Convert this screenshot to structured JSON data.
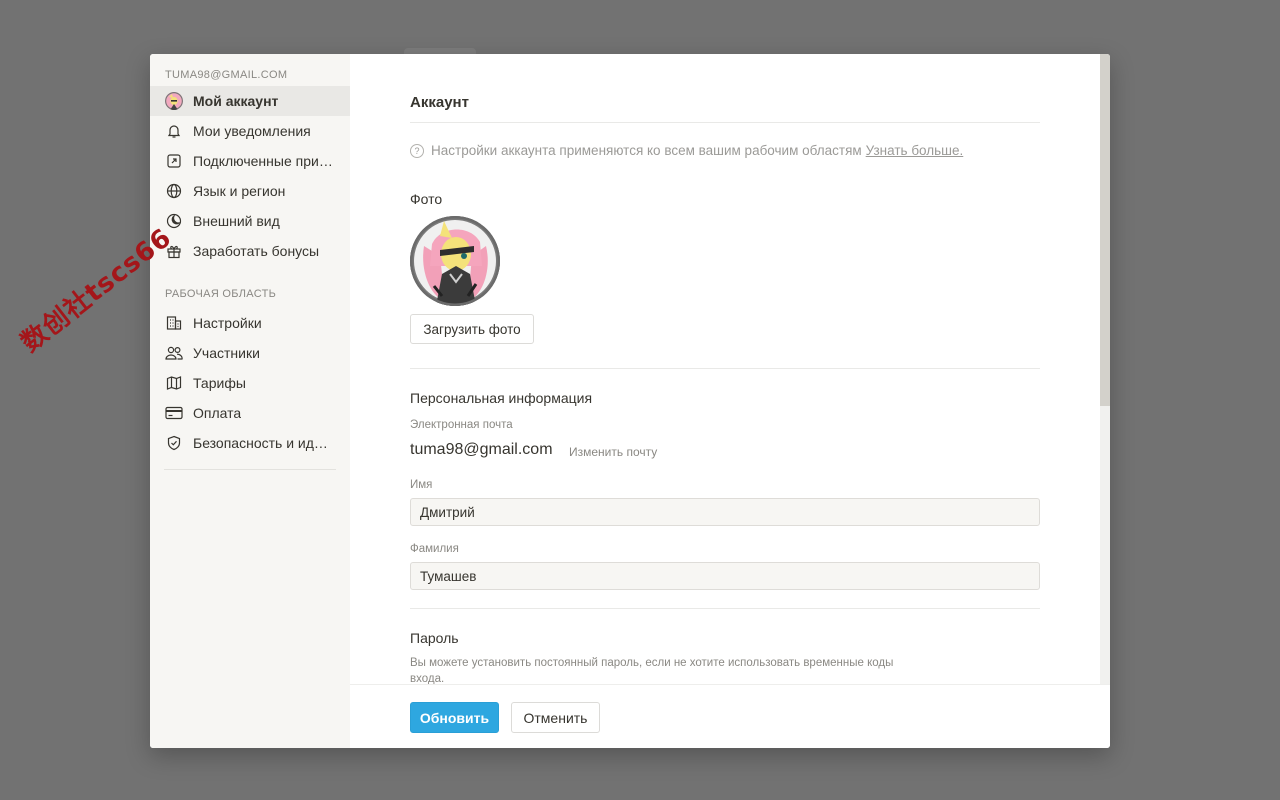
{
  "watermark": "数创社tscs66",
  "sidebar": {
    "account_email": "TUMA98@GMAIL.COM",
    "personal_items": [
      {
        "label": "Мой аккаунт",
        "icon": "user-avatar",
        "active": true
      },
      {
        "label": "Мои уведомления",
        "icon": "bell-icon"
      },
      {
        "label": "Подключенные приложения",
        "icon": "arrow-up-right-icon"
      },
      {
        "label": "Язык и регион",
        "icon": "globe-icon"
      },
      {
        "label": "Внешний вид",
        "icon": "moon-icon"
      },
      {
        "label": "Заработать бонусы",
        "icon": "gift-icon"
      }
    ],
    "workspace_header": "РАБОЧАЯ ОБЛАСТЬ",
    "workspace_items": [
      {
        "label": "Настройки",
        "icon": "building-icon"
      },
      {
        "label": "Участники",
        "icon": "people-icon"
      },
      {
        "label": "Тарифы",
        "icon": "map-icon"
      },
      {
        "label": "Оплата",
        "icon": "credit-card-icon"
      },
      {
        "label": "Безопасность и идентичность",
        "icon": "shield-check-icon"
      }
    ]
  },
  "main": {
    "title": "Аккаунт",
    "note_text": "Настройки аккаунта применяются ко всем вашим рабочим областям",
    "note_link": "Узнать больше.",
    "photo_label": "Фото",
    "upload_button": "Загрузить фото",
    "personal_info_header": "Персональная информация",
    "email_label": "Электронная почта",
    "email_value": "tuma98@gmail.com",
    "change_email": "Изменить почту",
    "first_name_label": "Имя",
    "first_name_value": "Дмитрий",
    "last_name_label": "Фамилия",
    "last_name_value": "Тумашев",
    "password_header": "Пароль",
    "password_desc": "Вы можете установить постоянный пароль, если не хотите использовать временные коды входа."
  },
  "footer": {
    "update_button": "Обновить",
    "cancel_button": "Отменить"
  },
  "colors": {
    "backdrop": "#727272",
    "sidebar_bg": "#f7f6f3",
    "accent": "#2ea7e0",
    "watermark": "#a4161a"
  }
}
